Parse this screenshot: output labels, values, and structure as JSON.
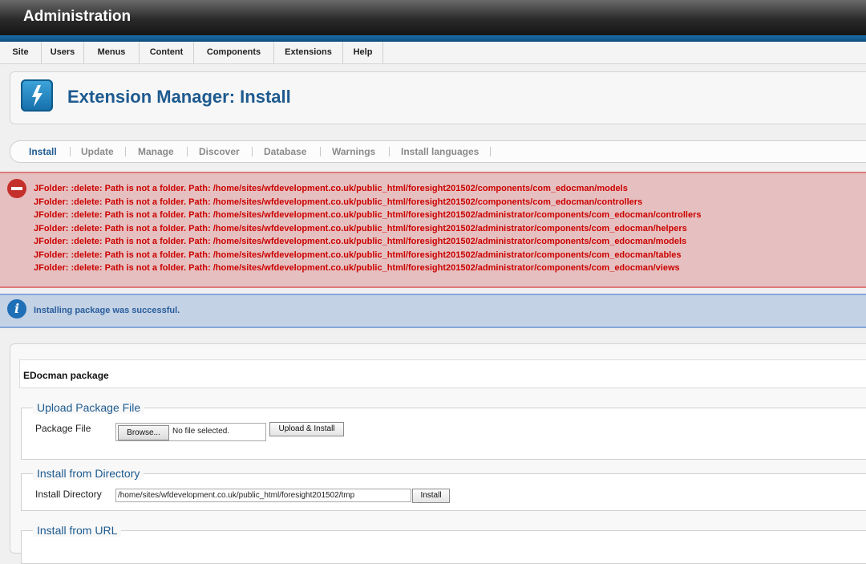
{
  "app": {
    "title": "Administration"
  },
  "menu": [
    "Site",
    "Users",
    "Menus",
    "Content",
    "Components",
    "Extensions",
    "Help"
  ],
  "header": {
    "title": "Extension Manager: Install",
    "icon": "lightning-bolt-icon"
  },
  "tabs": [
    "Install",
    "Update",
    "Manage",
    "Discover",
    "Database",
    "Warnings",
    "Install languages"
  ],
  "active_tab": "Install",
  "errors": [
    "JFolder: :delete: Path is not a folder. Path: /home/sites/wfdevelopment.co.uk/public_html/foresight201502/components/com_edocman/models",
    "JFolder: :delete: Path is not a folder. Path: /home/sites/wfdevelopment.co.uk/public_html/foresight201502/components/com_edocman/controllers",
    "JFolder: :delete: Path is not a folder. Path: /home/sites/wfdevelopment.co.uk/public_html/foresight201502/administrator/components/com_edocman/controllers",
    "JFolder: :delete: Path is not a folder. Path: /home/sites/wfdevelopment.co.uk/public_html/foresight201502/administrator/components/com_edocman/helpers",
    "JFolder: :delete: Path is not a folder. Path: /home/sites/wfdevelopment.co.uk/public_html/foresight201502/administrator/components/com_edocman/models",
    "JFolder: :delete: Path is not a folder. Path: /home/sites/wfdevelopment.co.uk/public_html/foresight201502/administrator/components/com_edocman/tables",
    "JFolder: :delete: Path is not a folder. Path: /home/sites/wfdevelopment.co.uk/public_html/foresight201502/administrator/components/com_edocman/views"
  ],
  "message": "Installing package was successful.",
  "package_name": "EDocman package",
  "upload": {
    "legend": "Upload Package File",
    "label": "Package File",
    "browse": "Browse...",
    "status": "No file selected.",
    "button": "Upload & Install"
  },
  "directory": {
    "legend": "Install from Directory",
    "label": "Install Directory",
    "value": "/home/sites/wfdevelopment.co.uk/public_html/foresight201502/tmp",
    "button": "Install"
  },
  "url": {
    "legend": "Install from URL"
  },
  "colors": {
    "accent": "#1d5a8f",
    "error": "#cc0000",
    "error_bg": "#e6c0c0",
    "info_bg": "#c3d2e5"
  }
}
